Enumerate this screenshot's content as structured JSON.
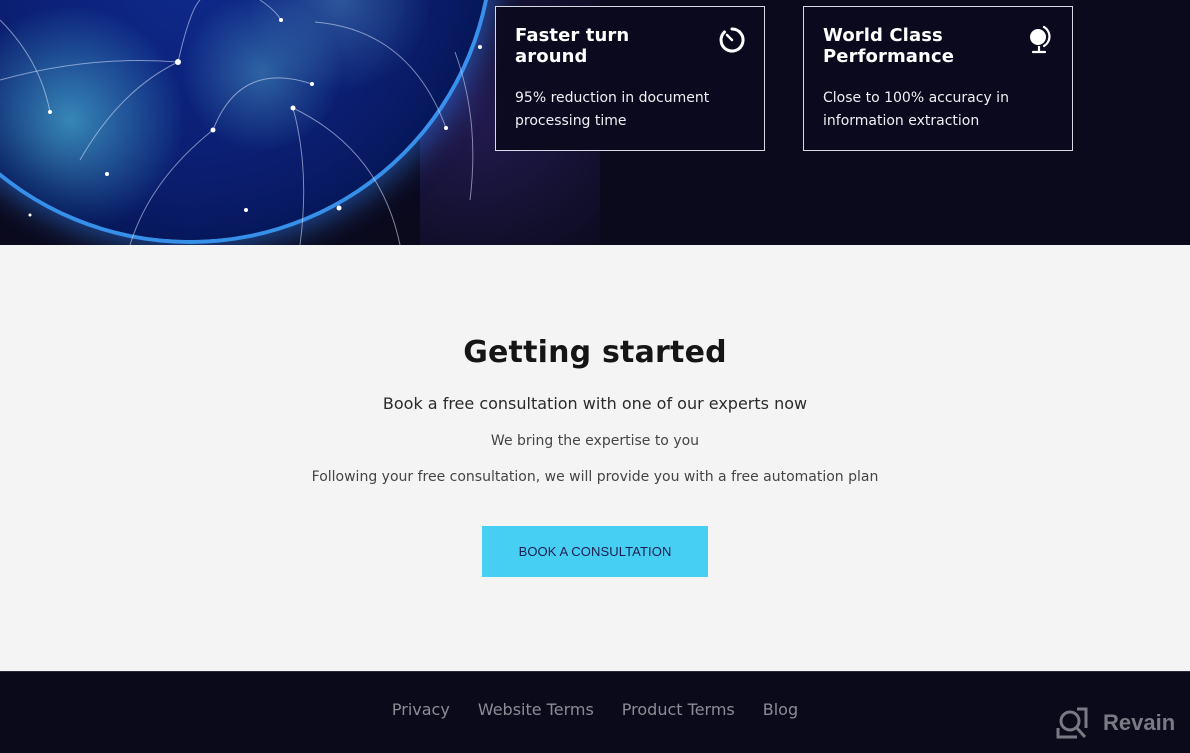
{
  "hero": {
    "features": [
      {
        "title": "Faster turn around",
        "title_line1": "Faster turn",
        "title_line2": "around",
        "description_line1": "95% reduction in document",
        "description_line2": "processing time",
        "icon": "stopwatch-icon"
      },
      {
        "title": "World Class Performance",
        "title_line1": "World Class",
        "title_line2": "Performance",
        "description_line1": "Close to 100% accuracy in",
        "description_line2": "information extraction",
        "icon": "globe-icon"
      }
    ]
  },
  "main": {
    "title": "Getting started",
    "subtitle": "Book a free consultation with one of our experts now",
    "line1": "We bring the expertise to you",
    "line2": "Following your free consultation, we will provide you with a free automation plan",
    "cta_label": "BOOK A CONSULTATION"
  },
  "footer": {
    "links": [
      "Privacy",
      "Website Terms",
      "Product Terms",
      "Blog"
    ]
  },
  "watermark": {
    "text": "Revain",
    "icon": "revain-logo-icon"
  },
  "colors": {
    "hero_bg": "#0b0a1d",
    "cta_bg": "#46cff2",
    "cta_text": "#1a2050",
    "footer_bg": "#0b0a1b",
    "footer_link": "#8c8c96",
    "main_bg": "#f4f4f4"
  }
}
